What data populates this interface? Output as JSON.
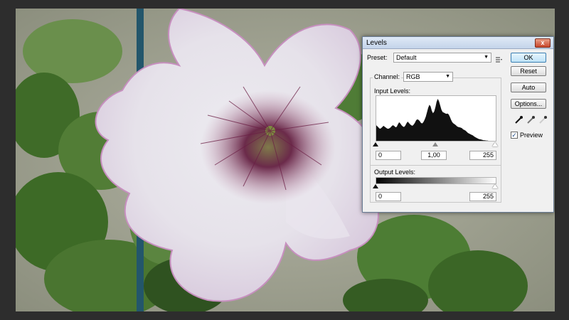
{
  "dialog": {
    "title": "Levels",
    "close_glyph": "x",
    "preset_label": "Preset:",
    "preset_value": "Default",
    "channel_label": "Channel:",
    "channel_value": "RGB",
    "input_levels_label": "Input Levels:",
    "input_black": "0",
    "input_gamma": "1,00",
    "input_white": "255",
    "output_levels_label": "Output Levels:",
    "output_black": "0",
    "output_white": "255",
    "buttons": {
      "ok": "OK",
      "reset": "Reset",
      "auto": "Auto",
      "options": "Options..."
    },
    "preview_label": "Preview",
    "preview_checked": true,
    "icons": [
      "preset-menu-icon",
      "black-eyedropper-icon",
      "gray-eyedropper-icon",
      "white-eyedropper-icon"
    ]
  },
  "histogram": [
    52,
    48,
    44,
    40,
    42,
    46,
    50,
    47,
    44,
    41,
    40,
    42,
    45,
    50,
    52,
    49,
    45,
    47,
    55,
    62,
    58,
    52,
    48,
    46,
    50,
    58,
    64,
    60,
    55,
    52,
    50,
    54,
    60,
    68,
    72,
    70,
    66,
    60,
    58,
    62,
    70,
    80,
    95,
    110,
    120,
    115,
    100,
    92,
    98,
    112,
    130,
    140,
    132,
    118,
    104,
    96,
    94,
    92,
    90,
    91,
    88,
    80,
    70,
    62,
    58,
    55,
    52,
    48,
    46,
    45,
    44,
    42,
    38,
    36,
    34,
    30,
    26,
    24,
    22,
    20,
    18,
    15,
    12,
    10,
    8,
    6,
    5,
    4,
    3,
    2,
    2,
    1,
    1,
    0,
    0,
    0,
    0,
    0,
    0,
    0
  ]
}
